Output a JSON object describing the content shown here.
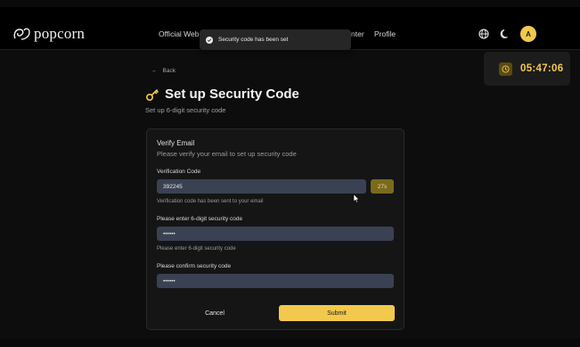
{
  "header": {
    "logo_text": "popcorn",
    "nav": [
      {
        "label": "Official Webs"
      },
      {
        "label": "nter"
      },
      {
        "label": "Profile"
      }
    ],
    "avatar_letter": "A",
    "icons": [
      "globe-icon",
      "moon-icon"
    ]
  },
  "toast": {
    "text": "Security code has been set",
    "icon": "check-circle-icon"
  },
  "timer": {
    "value": "05:47:06",
    "icon": "clock-icon"
  },
  "page": {
    "back_label": "Back",
    "title": "Set up Security Code",
    "subtitle": "Set up 6-digit security code"
  },
  "form": {
    "section_title": "Verify Email",
    "section_desc": "Please verify your email to set up security code",
    "verification": {
      "label": "Verification Code",
      "value": "392245",
      "countdown": "27s",
      "helper": "Verification code has been sent to your email"
    },
    "security": {
      "label": "Please enter 6-digit security code",
      "value": "••••••",
      "helper": "Please enter 6-digit security code"
    },
    "confirm": {
      "label": "Please confirm security code",
      "value": "••••••"
    },
    "cancel_label": "Cancel",
    "submit_label": "Submit"
  },
  "colors": {
    "accent": "#f2c94c",
    "background": "#0d0d0d",
    "input": "#3a4152"
  }
}
